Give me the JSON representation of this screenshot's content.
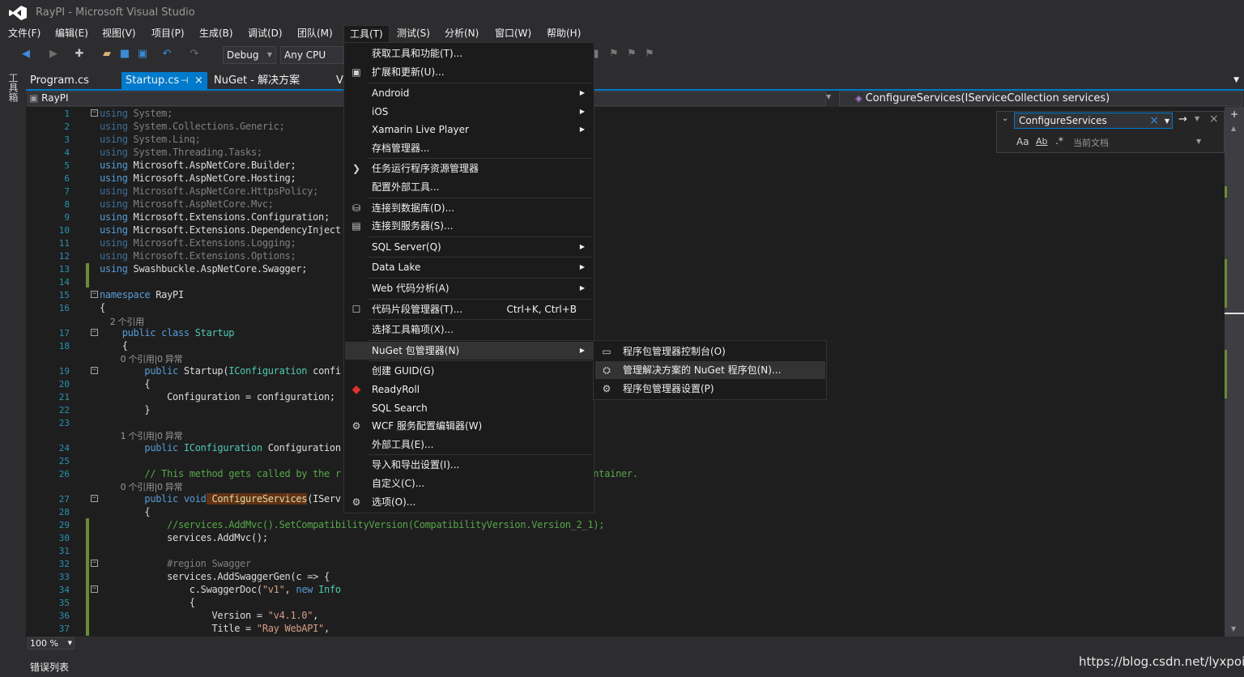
{
  "window": {
    "title": "RayPI - Microsoft Visual Studio",
    "logo_icon": "visual-studio-logo"
  },
  "menubar": {
    "items": [
      "文件(F)",
      "编辑(E)",
      "视图(V)",
      "项目(P)",
      "生成(B)",
      "调试(D)",
      "团队(M)",
      "工具(T)",
      "测试(S)",
      "分析(N)",
      "窗口(W)",
      "帮助(H)"
    ],
    "active": "工具(T)"
  },
  "toolbar": {
    "config": "Debug",
    "platform": "Any CPU"
  },
  "toolbox": {
    "label": "工具箱"
  },
  "tabs": [
    {
      "label": "Program.cs"
    },
    {
      "label": "Startup.cs",
      "pin": "⊣",
      "close": "×"
    },
    {
      "label": "NuGet - 解决方案"
    },
    {
      "label": "V"
    }
  ],
  "navbar": {
    "project": "RayPI",
    "member": "ConfigureServices(IServiceCollection services)"
  },
  "editor": {
    "lines": [
      {
        "n": "1",
        "parts": [
          {
            "c": "dimkw",
            "t": "using"
          },
          {
            "c": "dim",
            "t": " System;"
          }
        ]
      },
      {
        "n": "2",
        "parts": [
          {
            "c": "dimkw",
            "t": "using"
          },
          {
            "c": "dim",
            "t": " System.Collections.Generic;"
          }
        ]
      },
      {
        "n": "3",
        "parts": [
          {
            "c": "dimkw",
            "t": "using"
          },
          {
            "c": "dim",
            "t": " System.Linq;"
          }
        ]
      },
      {
        "n": "4",
        "parts": [
          {
            "c": "dimkw",
            "t": "using"
          },
          {
            "c": "dim",
            "t": " System.Threading.Tasks;"
          }
        ]
      },
      {
        "n": "5",
        "parts": [
          {
            "c": "kw",
            "t": "using"
          },
          {
            "c": "",
            "t": " Microsoft.AspNetCore.Builder;"
          }
        ]
      },
      {
        "n": "6",
        "parts": [
          {
            "c": "kw",
            "t": "using"
          },
          {
            "c": "",
            "t": " Microsoft.AspNetCore.Hosting;"
          }
        ]
      },
      {
        "n": "7",
        "parts": [
          {
            "c": "dimkw",
            "t": "using"
          },
          {
            "c": "dim",
            "t": " Microsoft.AspNetCore.HttpsPolicy;"
          }
        ]
      },
      {
        "n": "8",
        "parts": [
          {
            "c": "dimkw",
            "t": "using"
          },
          {
            "c": "dim",
            "t": " Microsoft.AspNetCore.Mvc;"
          }
        ]
      },
      {
        "n": "9",
        "parts": [
          {
            "c": "kw",
            "t": "using"
          },
          {
            "c": "",
            "t": " Microsoft.Extensions.Configuration;"
          }
        ]
      },
      {
        "n": "10",
        "parts": [
          {
            "c": "kw",
            "t": "using"
          },
          {
            "c": "",
            "t": " Microsoft.Extensions.DependencyInject"
          }
        ]
      },
      {
        "n": "11",
        "parts": [
          {
            "c": "dimkw",
            "t": "using"
          },
          {
            "c": "dim",
            "t": " Microsoft.Extensions.Logging;"
          }
        ]
      },
      {
        "n": "12",
        "parts": [
          {
            "c": "dimkw",
            "t": "using"
          },
          {
            "c": "dim",
            "t": " Microsoft.Extensions.Options;"
          }
        ]
      },
      {
        "n": "13",
        "parts": [
          {
            "c": "kw",
            "t": "using"
          },
          {
            "c": "",
            "t": " Swashbuckle.AspNetCore.Swagger;"
          }
        ]
      },
      {
        "n": "14",
        "parts": []
      },
      {
        "n": "15",
        "parts": [
          {
            "c": "kw",
            "t": "namespace"
          },
          {
            "c": "",
            "t": " RayPI"
          }
        ]
      },
      {
        "n": "16",
        "parts": [
          {
            "c": "",
            "t": "{"
          }
        ]
      },
      {
        "n": "",
        "parts": [
          {
            "c": "ref",
            "t": "    2 个引用"
          }
        ]
      },
      {
        "n": "17",
        "parts": [
          {
            "c": "kw",
            "t": "    public class"
          },
          {
            "c": "ty",
            "t": " Startup"
          }
        ]
      },
      {
        "n": "18",
        "parts": [
          {
            "c": "",
            "t": "    {"
          }
        ]
      },
      {
        "n": "",
        "parts": [
          {
            "c": "ref",
            "t": "        0 个引用|0 异常"
          }
        ]
      },
      {
        "n": "19",
        "parts": [
          {
            "c": "kw",
            "t": "        public"
          },
          {
            "c": "",
            "t": " Startup("
          },
          {
            "c": "ty",
            "t": "IConfiguration"
          },
          {
            "c": "",
            "t": " confi"
          }
        ]
      },
      {
        "n": "20",
        "parts": [
          {
            "c": "",
            "t": "        {"
          }
        ]
      },
      {
        "n": "21",
        "parts": [
          {
            "c": "",
            "t": "            Configuration = configuration;"
          }
        ]
      },
      {
        "n": "22",
        "parts": [
          {
            "c": "",
            "t": "        }"
          }
        ]
      },
      {
        "n": "23",
        "parts": []
      },
      {
        "n": "",
        "parts": [
          {
            "c": "ref",
            "t": "        1 个引用|0 异常"
          }
        ]
      },
      {
        "n": "24",
        "parts": [
          {
            "c": "kw",
            "t": "        public"
          },
          {
            "c": "ty",
            "t": " IConfiguration"
          },
          {
            "c": "",
            "t": " Configuration"
          }
        ]
      },
      {
        "n": "25",
        "parts": []
      },
      {
        "n": "26",
        "parts": [
          {
            "c": "cm",
            "t": "        // This method gets called by the r                                        he container."
          }
        ]
      },
      {
        "n": "",
        "parts": [
          {
            "c": "ref",
            "t": "        0 个引用|0 异常"
          }
        ]
      },
      {
        "n": "27",
        "parts": [
          {
            "c": "kw",
            "t": "        public void"
          },
          {
            "c": "hl",
            "t": " ConfigureServices"
          },
          {
            "c": "",
            "t": "(IServ"
          }
        ]
      },
      {
        "n": "28",
        "parts": [
          {
            "c": "",
            "t": "        {"
          }
        ]
      },
      {
        "n": "29",
        "parts": [
          {
            "c": "cm",
            "t": "            //services.AddMvc().SetCompatibilityVersion(CompatibilityVersion.Version_2_1);"
          }
        ]
      },
      {
        "n": "30",
        "parts": [
          {
            "c": "",
            "t": "            services.AddMvc();"
          }
        ]
      },
      {
        "n": "31",
        "parts": []
      },
      {
        "n": "32",
        "parts": [
          {
            "c": "dim",
            "t": "            #region Swagger"
          }
        ]
      },
      {
        "n": "33",
        "parts": [
          {
            "c": "",
            "t": "            services.AddSwaggerGen(c => {"
          }
        ]
      },
      {
        "n": "34",
        "parts": [
          {
            "c": "",
            "t": "                c.SwaggerDoc("
          },
          {
            "c": "str",
            "t": "\"v1\""
          },
          {
            "c": "",
            "t": ", "
          },
          {
            "c": "kw",
            "t": "new"
          },
          {
            "c": "ty",
            "t": " Info"
          }
        ]
      },
      {
        "n": "35",
        "parts": [
          {
            "c": "",
            "t": "                {"
          }
        ]
      },
      {
        "n": "36",
        "parts": [
          {
            "c": "",
            "t": "                    Version = "
          },
          {
            "c": "str",
            "t": "\"v4.1.0\""
          },
          {
            "c": "",
            "t": ","
          }
        ]
      },
      {
        "n": "37",
        "parts": [
          {
            "c": "",
            "t": "                    Title = "
          },
          {
            "c": "str",
            "t": "\"Ray WebAPI\""
          },
          {
            "c": "",
            "t": ","
          }
        ]
      }
    ]
  },
  "find": {
    "value": "ConfigureServices",
    "scope": "当前文档",
    "options": [
      "Aa",
      "Ab",
      ".*"
    ]
  },
  "tools_menu": {
    "items": [
      {
        "label": "获取工具和功能(T)...",
        "icon": ""
      },
      {
        "label": "扩展和更新(U)...",
        "icon": "extensions-icon"
      },
      {
        "sep": true
      },
      {
        "label": "Android",
        "sub": true
      },
      {
        "label": "iOS",
        "sub": true
      },
      {
        "label": "Xamarin Live Player",
        "sub": true
      },
      {
        "label": "存档管理器...",
        "icon": ""
      },
      {
        "sep": true
      },
      {
        "label": "任务运行程序资源管理器",
        "icon": "task-runner-icon"
      },
      {
        "label": "配置外部工具..."
      },
      {
        "sep": true
      },
      {
        "label": "连接到数据库(D)...",
        "icon": "connect-database-icon"
      },
      {
        "label": "连接到服务器(S)...",
        "icon": "connect-server-icon"
      },
      {
        "sep": true
      },
      {
        "label": "SQL Server(Q)",
        "sub": true
      },
      {
        "sep": true
      },
      {
        "label": "Data Lake",
        "sub": true
      },
      {
        "sep": true
      },
      {
        "label": "Web 代码分析(A)",
        "sub": true
      },
      {
        "sep": true
      },
      {
        "label": "代码片段管理器(T)...",
        "icon": "snippet-icon",
        "shortcut": "Ctrl+K, Ctrl+B"
      },
      {
        "sep": true
      },
      {
        "label": "选择工具箱项(X)..."
      },
      {
        "sep": true
      },
      {
        "label": "NuGet 包管理器(N)",
        "sub": true,
        "hl": true
      },
      {
        "sep": true
      },
      {
        "label": "创建 GUID(G)"
      },
      {
        "label": "ReadyRoll",
        "icon": "readyroll-icon"
      },
      {
        "label": "SQL Search"
      },
      {
        "label": "WCF 服务配置编辑器(W)",
        "icon": "wcf-config-icon"
      },
      {
        "label": "外部工具(E)..."
      },
      {
        "sep": true
      },
      {
        "label": "导入和导出设置(I)..."
      },
      {
        "label": "自定义(C)..."
      },
      {
        "label": "选项(O)...",
        "icon": "gear-icon"
      }
    ]
  },
  "nuget_submenu": {
    "items": [
      {
        "label": "程序包管理器控制台(O)",
        "icon": "console-icon"
      },
      {
        "label": "管理解决方案的 NuGet 程序包(N)...",
        "icon": "nuget-package-icon",
        "hl": true
      },
      {
        "label": "程序包管理器设置(P)",
        "icon": "gear-icon"
      }
    ]
  },
  "statusbar": {
    "zoom": "100 %",
    "error_list": "错误列表"
  },
  "watermark": "https://blog.csdn.net/lyxpoid",
  "colors": {
    "accent": "#007acc",
    "background": "#2d2d30",
    "editor": "#1e1e1e",
    "menu": "#1b1b1c"
  }
}
